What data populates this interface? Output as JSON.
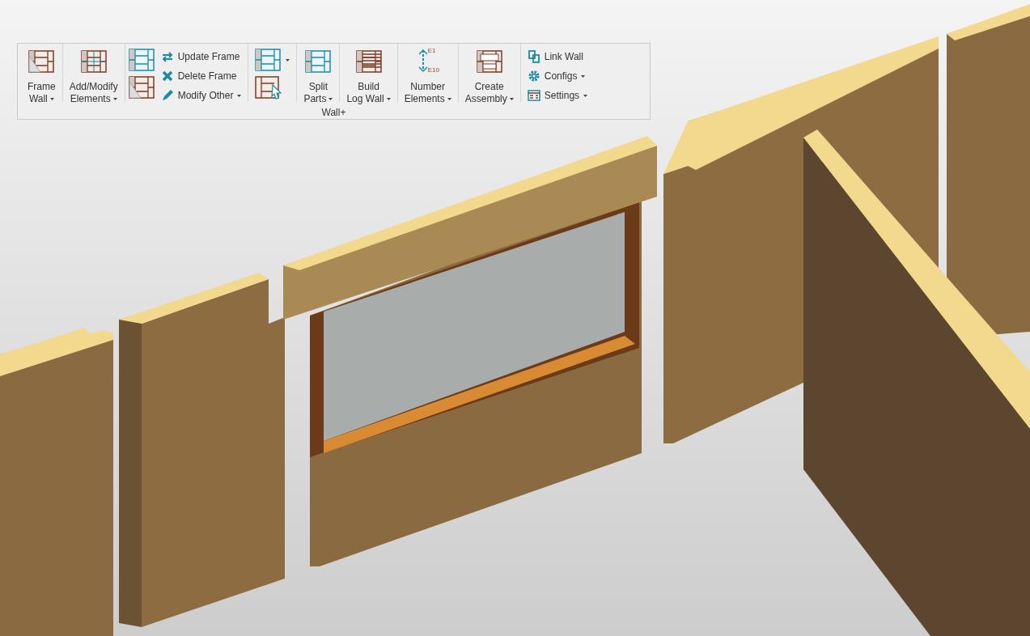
{
  "panel": {
    "title": "Wall+",
    "groups": [
      {
        "kind": "large",
        "lines": [
          "Frame",
          "Wall"
        ],
        "dropdown": true
      },
      {
        "kind": "large",
        "lines": [
          "Add/Modify",
          "Elements"
        ],
        "dropdown": true
      },
      {
        "kind": "stack",
        "items": [
          {
            "label": "Update Frame",
            "dropdown": false
          },
          {
            "label": "Delete Frame",
            "dropdown": false
          },
          {
            "label": "Modify Other",
            "dropdown": true
          }
        ]
      },
      {
        "kind": "icons",
        "dropdown": true
      },
      {
        "kind": "large",
        "lines": [
          "Split",
          "Parts"
        ],
        "dropdown": true
      },
      {
        "kind": "large",
        "lines": [
          "Build",
          "Log Wall"
        ],
        "dropdown": true
      },
      {
        "kind": "large",
        "lines": [
          "Number",
          "Elements"
        ],
        "dropdown": true,
        "tags": [
          "E1",
          "E10"
        ]
      },
      {
        "kind": "large",
        "lines": [
          "Create",
          "Assembly"
        ],
        "dropdown": true
      },
      {
        "kind": "small",
        "items": [
          {
            "label": "Link Wall",
            "dropdown": false
          },
          {
            "label": "Configs",
            "dropdown": true
          },
          {
            "label": "Settings",
            "dropdown": true
          }
        ]
      }
    ]
  }
}
